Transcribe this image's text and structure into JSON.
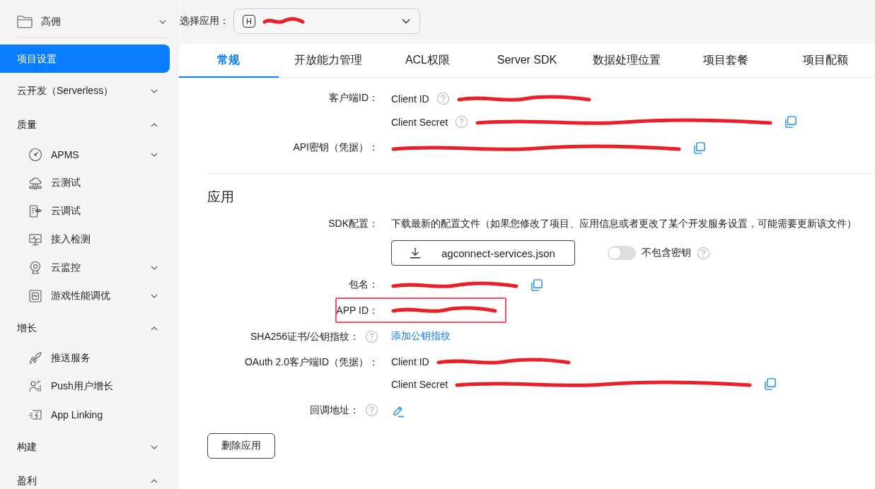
{
  "sidebar": {
    "project": {
      "name": "高佣",
      "expanded": false
    },
    "items": [
      {
        "label": "项目设置",
        "kind": "link",
        "selected": true
      },
      {
        "label": "云开发（Serverless）",
        "kind": "group",
        "selected": false,
        "expanded": false
      },
      {
        "label": "质量",
        "kind": "group",
        "selected": false,
        "expanded": true,
        "children": [
          {
            "label": "APMS",
            "selected": false,
            "expanded": false
          },
          {
            "label": "云测试",
            "selected": false
          },
          {
            "label": "云调试",
            "selected": false
          },
          {
            "label": "接入检测",
            "selected": false
          },
          {
            "label": "云监控",
            "selected": false,
            "expanded": false
          },
          {
            "label": "游戏性能调优",
            "selected": false,
            "expanded": false
          }
        ]
      },
      {
        "label": "增长",
        "kind": "group",
        "selected": false,
        "expanded": true,
        "children": [
          {
            "label": "推送服务",
            "selected": false
          },
          {
            "label": "Push用户增长",
            "selected": false
          },
          {
            "label": "App Linking",
            "selected": false
          }
        ]
      },
      {
        "label": "构建",
        "kind": "group",
        "selected": false,
        "expanded": false
      },
      {
        "label": "盈利",
        "kind": "group",
        "selected": false,
        "expanded": true
      }
    ]
  },
  "app_picker": {
    "label": "选择应用：",
    "avatar": "H",
    "redacted": true
  },
  "tabs": [
    {
      "label": "常规",
      "selected": true
    },
    {
      "label": "开放能力管理",
      "selected": false
    },
    {
      "label": "ACL权限",
      "selected": false
    },
    {
      "label": "Server SDK",
      "selected": false
    },
    {
      "label": "数据处理位置",
      "selected": false
    },
    {
      "label": "项目套餐",
      "selected": false
    },
    {
      "label": "项目配额",
      "selected": false
    }
  ],
  "client_section": {
    "rows": [
      {
        "label": "客户端ID：",
        "kind": "subs",
        "subs": [
          {
            "name": "Client ID",
            "help": true,
            "redacted": true,
            "copy": false
          },
          {
            "name": "Client Secret",
            "help": true,
            "redacted": true,
            "copy": true
          }
        ]
      },
      {
        "label": "API密钥（凭据）：",
        "kind": "value",
        "redacted": true,
        "copy": true
      }
    ]
  },
  "app_section": {
    "title": "应用",
    "rows": [
      {
        "label": "SDK配置：",
        "kind": "sdk",
        "description": "下载最新的配置文件（如果您修改了项目、应用信息或者更改了某个开发服务设置，可能需要更新该文件）",
        "download": "agconnect-services.json",
        "toggle": {
          "label": "不包含密钥",
          "on": false,
          "help": true
        }
      },
      {
        "label": "包名：",
        "kind": "value",
        "redacted": true,
        "copy": true
      },
      {
        "label": "APP ID：",
        "kind": "value",
        "redacted": true,
        "copy": false,
        "highlighted": true
      },
      {
        "label": "SHA256证书/公钥指纹：",
        "kind": "link",
        "help": true,
        "link": "添加公钥指纹"
      },
      {
        "label": "OAuth 2.0客户端ID（凭据）：",
        "kind": "subs",
        "subs": [
          {
            "name": "Client ID",
            "help": false,
            "redacted": true,
            "copy": false
          },
          {
            "name": "Client Secret",
            "help": false,
            "redacted": true,
            "copy": true
          }
        ]
      },
      {
        "label": "回调地址：",
        "kind": "edit",
        "help": true
      }
    ],
    "delete_button": "删除应用"
  }
}
